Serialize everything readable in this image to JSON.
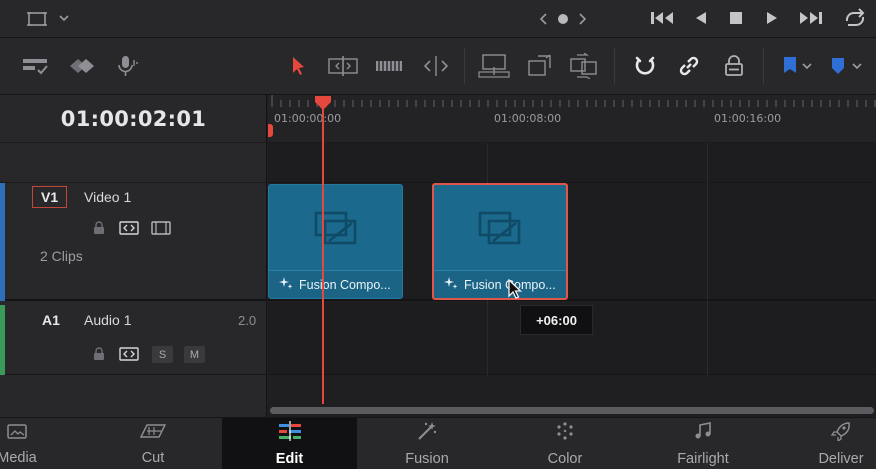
{
  "timeline": {
    "timecode": "01:00:02:01",
    "ruler_labels": [
      "01:00:00:00",
      "01:00:08:00",
      "01:00:16:00"
    ],
    "tooltip": "+06:00"
  },
  "tracks": {
    "video": {
      "badge": "V1",
      "name": "Video 1",
      "clip_count": "2 Clips"
    },
    "audio": {
      "badge": "A1",
      "name": "Audio 1",
      "level": "2.0",
      "solo_label": "S",
      "mute_label": "M"
    }
  },
  "clips": [
    {
      "label": "Fusion Compo..."
    },
    {
      "label": "Fusion Compo..."
    }
  ],
  "pages": [
    {
      "label": "Media"
    },
    {
      "label": "Cut"
    },
    {
      "label": "Edit"
    },
    {
      "label": "Fusion"
    },
    {
      "label": "Color"
    },
    {
      "label": "Fairlight"
    },
    {
      "label": "Deliver"
    }
  ],
  "colors": {
    "accent": "#e5483c",
    "clip_blue": "#1b6a8e",
    "flag_blue": "#2f6fd6"
  }
}
